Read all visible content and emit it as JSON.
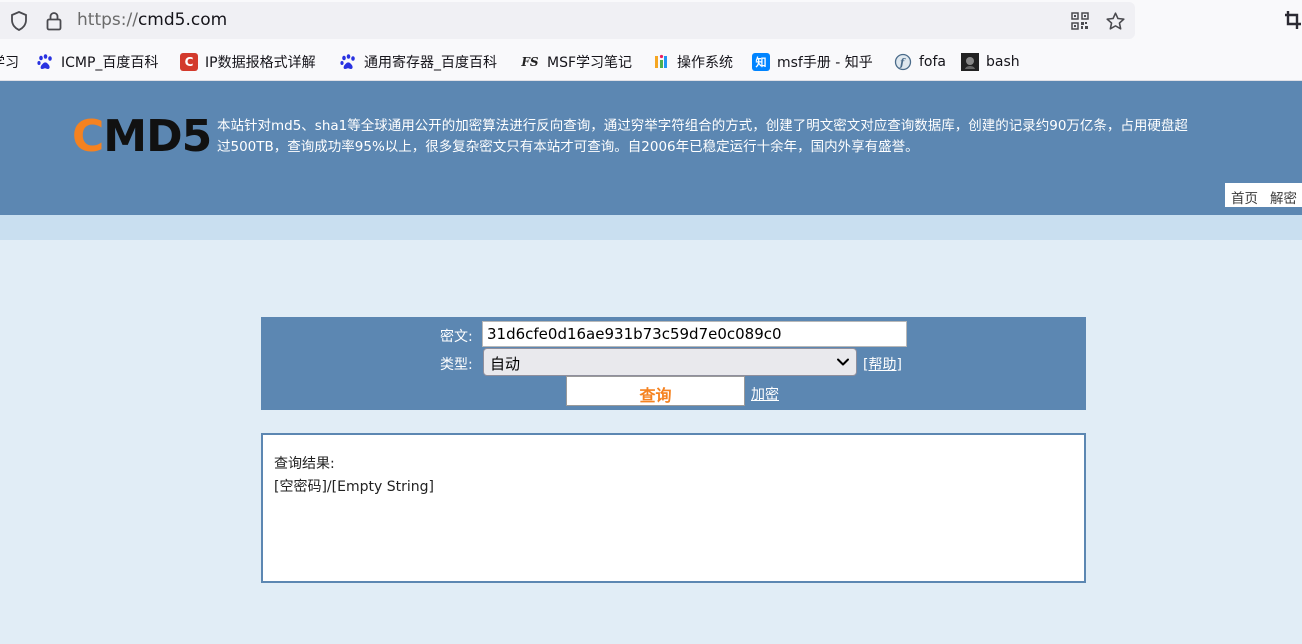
{
  "browser": {
    "url_scheme": "https://",
    "url_host": "cmd5.com",
    "bookmarks": [
      {
        "label": "学习",
        "icon": "bookmark-icon",
        "color": "#555555"
      },
      {
        "label": "ICMP_百度百科",
        "icon": "baidu-paw-icon",
        "color": "#2932e1"
      },
      {
        "label": "IP数据报格式详解",
        "icon": "csdn-c-icon",
        "color": "#d33a2c"
      },
      {
        "label": "通用寄存器_百度百科",
        "icon": "baidu-paw-icon",
        "color": "#2932e1"
      },
      {
        "label": "MSF学习笔记",
        "icon": "fs-logo-icon",
        "color": "#222222"
      },
      {
        "label": "操作系统",
        "icon": "colorful-u-icon",
        "color": "#f5a623"
      },
      {
        "label": "msf手册 - 知乎",
        "icon": "zhihu-icon",
        "color": "#0084ff"
      },
      {
        "label": "fofa",
        "icon": "fofa-icon",
        "color": "#4a6b8a"
      },
      {
        "label": "bash",
        "icon": "bash-icon",
        "color": "#222222"
      }
    ]
  },
  "site": {
    "logo_c": "C",
    "logo_rest": "MD5",
    "intro_line1": "本站针对md5、sha1等全球通用公开的加密算法进行反向查询，通过穷举字符组合的方式，创建了明文密文对应查询数据库，创建的记录约90万亿条，占用硬盘超",
    "intro_line2": "过500TB，查询成功率95%以上，很多复杂密文只有本站才可查询。自2006年已稳定运行十余年，国内外享有盛誉。",
    "nav_home": "首页",
    "nav_decrypt": "解密"
  },
  "form": {
    "ciphertext_label": "密文:",
    "ciphertext_value": "31d6cfe0d16ae931b73c59d7e0c089c0",
    "type_label": "类型:",
    "type_value": "自动",
    "help_link": "[帮助]",
    "query_button": "查询",
    "encrypt_link": "加密"
  },
  "result": {
    "title": "查询结果:",
    "value": "[空密码]/[Empty String]"
  },
  "colors": {
    "header_bg": "#5c87b2",
    "page_bg": "#e1edf6",
    "accent_orange": "#f58220"
  }
}
